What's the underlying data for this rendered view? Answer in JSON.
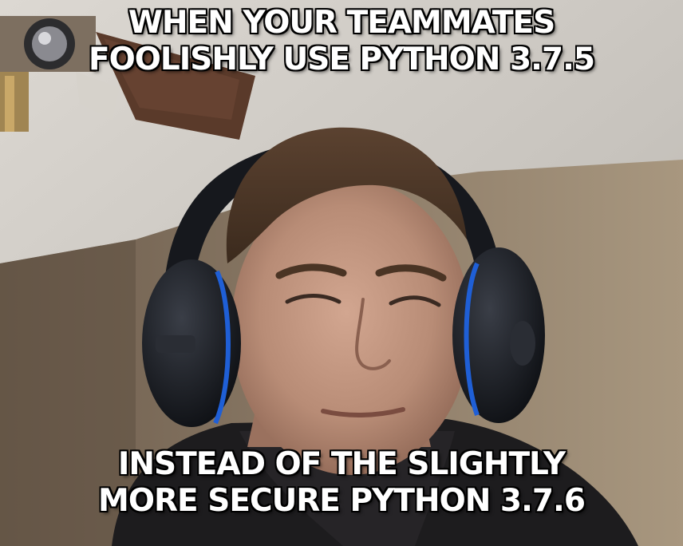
{
  "meme": {
    "top_text": [
      "WHEN YOUR TEAMMATES",
      "FOOLISHLY USE PYTHON 3.7.5"
    ],
    "bottom_text": [
      "INSTEAD OF THE SLIGHTLY",
      "MORE SECURE PYTHON 3.7.6"
    ]
  },
  "colors": {
    "caption_fill": "#ffffff",
    "caption_outline": "#000000",
    "ceiling": "#c9c6c1",
    "wall": "#8d7c68",
    "skin": "#b98d78",
    "hair": "#4a3424",
    "headphones": "#15171c",
    "headphone_accent": "#1f5fd6"
  },
  "scene": {
    "elements": [
      "ceiling-fan",
      "headphones",
      "person-face",
      "hoodie"
    ]
  }
}
